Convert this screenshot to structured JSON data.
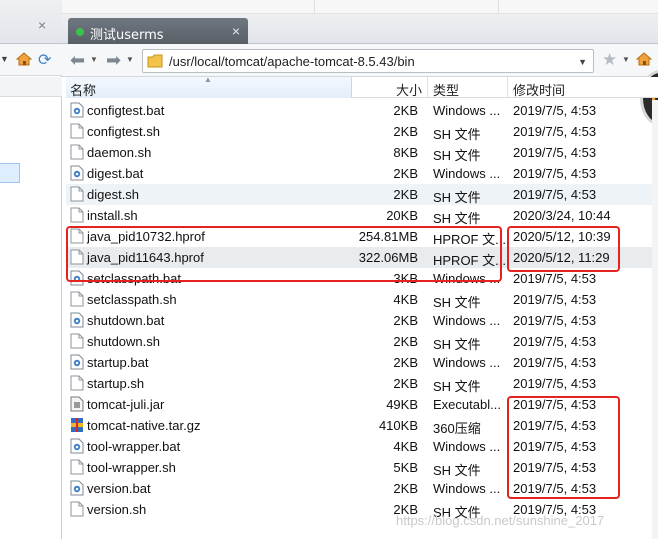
{
  "tab": {
    "title": "测试userms",
    "close": "×"
  },
  "address": {
    "path": "/usr/local/tomcat/apache-tomcat-8.5.43/bin"
  },
  "columns": {
    "name": "名称",
    "size": "大小",
    "type": "类型",
    "modified": "修改时间"
  },
  "files": [
    {
      "icon": "bat-file-icon",
      "name": "configtest.bat",
      "size": "2KB",
      "type": "Windows ...",
      "modified": "2019/7/5, 4:53"
    },
    {
      "icon": "text-file-icon",
      "name": "configtest.sh",
      "size": "2KB",
      "type": "SH 文件",
      "modified": "2019/7/5, 4:53"
    },
    {
      "icon": "text-file-icon",
      "name": "daemon.sh",
      "size": "8KB",
      "type": "SH 文件",
      "modified": "2019/7/5, 4:53"
    },
    {
      "icon": "bat-file-icon",
      "name": "digest.bat",
      "size": "2KB",
      "type": "Windows ...",
      "modified": "2019/7/5, 4:53"
    },
    {
      "icon": "text-file-icon",
      "name": "digest.sh",
      "size": "2KB",
      "type": "SH 文件",
      "modified": "2019/7/5, 4:53"
    },
    {
      "icon": "text-file-icon",
      "name": "install.sh",
      "size": "20KB",
      "type": "SH 文件",
      "modified": "2020/3/24, 10:44"
    },
    {
      "icon": "text-file-icon",
      "name": "java_pid10732.hprof",
      "size": "254.81MB",
      "type": "HPROF 文...",
      "modified": "2020/5/12, 10:39"
    },
    {
      "icon": "text-file-icon",
      "name": "java_pid11643.hprof",
      "size": "322.06MB",
      "type": "HPROF 文...",
      "modified": "2020/5/12, 11:29"
    },
    {
      "icon": "bat-file-icon",
      "name": "setclasspath.bat",
      "size": "3KB",
      "type": "Windows ...",
      "modified": "2019/7/5, 4:53"
    },
    {
      "icon": "text-file-icon",
      "name": "setclasspath.sh",
      "size": "4KB",
      "type": "SH 文件",
      "modified": "2019/7/5, 4:53"
    },
    {
      "icon": "bat-file-icon",
      "name": "shutdown.bat",
      "size": "2KB",
      "type": "Windows ...",
      "modified": "2019/7/5, 4:53"
    },
    {
      "icon": "text-file-icon",
      "name": "shutdown.sh",
      "size": "2KB",
      "type": "SH 文件",
      "modified": "2019/7/5, 4:53"
    },
    {
      "icon": "bat-file-icon",
      "name": "startup.bat",
      "size": "2KB",
      "type": "Windows ...",
      "modified": "2019/7/5, 4:53"
    },
    {
      "icon": "text-file-icon",
      "name": "startup.sh",
      "size": "2KB",
      "type": "SH 文件",
      "modified": "2019/7/5, 4:53"
    },
    {
      "icon": "jar-file-icon",
      "name": "tomcat-juli.jar",
      "size": "49KB",
      "type": "Executabl...",
      "modified": "2019/7/5, 4:53"
    },
    {
      "icon": "archive-file-icon",
      "name": "tomcat-native.tar.gz",
      "size": "410KB",
      "type": "360压缩",
      "modified": "2019/7/5, 4:53"
    },
    {
      "icon": "bat-file-icon",
      "name": "tool-wrapper.bat",
      "size": "4KB",
      "type": "Windows ...",
      "modified": "2019/7/5, 4:53"
    },
    {
      "icon": "text-file-icon",
      "name": "tool-wrapper.sh",
      "size": "5KB",
      "type": "SH 文件",
      "modified": "2019/7/5, 4:53"
    },
    {
      "icon": "bat-file-icon",
      "name": "version.bat",
      "size": "2KB",
      "type": "Windows ...",
      "modified": "2019/7/5, 4:53"
    },
    {
      "icon": "text-file-icon",
      "name": "version.sh",
      "size": "2KB",
      "type": "SH 文件",
      "modified": "2019/7/5, 4:53"
    }
  ],
  "watermark": "https://blog.csdn.net/sunshine_2017",
  "colors": {
    "tab_bg": "#5f666e",
    "tab_dot": "#3cc24a",
    "annotation_red": "#e4231e",
    "header_active": "#e3eefa"
  }
}
